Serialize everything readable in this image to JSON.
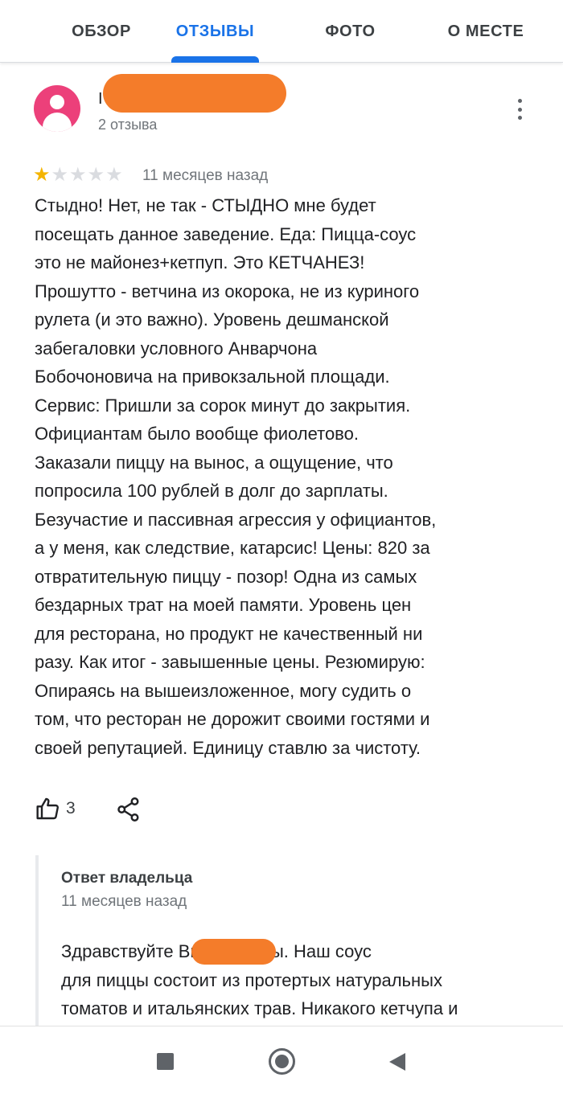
{
  "tabs": [
    {
      "label": "ОБЗОР",
      "active": false
    },
    {
      "label": "ОТЗЫВЫ",
      "active": true
    },
    {
      "label": "ФОТО",
      "active": false
    },
    {
      "label": "О МЕСТЕ",
      "active": false
    }
  ],
  "review": {
    "author_initial": "I",
    "author_review_count": "2 отзыва",
    "rating": 1,
    "rating_max": 5,
    "date": "11 месяцев назад",
    "text": "Стыдно! Нет, не так - СТЫДНО мне будет\nпосещать данное заведение. Еда: Пицца-соус\nэто не майонез+кетпуп. Это КЕТЧАНЕЗ!\nПрошутто - ветчина из окорока, не из куриного\nрулета (и это важно). Уровень дешманской\nзабегаловки условного Анварчона\nБобочоновича на привокзальной площади.\nСервис: Пришли за сорок минут до закрытия.\nОфициантам было вообще фиолетово.\nЗаказали пиццу на вынос, а ощущение, что\nпопросила 100 рублей в долг до зарплаты.\nБезучастие и пассивная агрессия у официантов,\nа у меня, как следствие, катарсис! Цены: 820 за\nотвратительную пиццу - позор!  Одна из самых\nбездарных трат на моей памяти. Уровень цен\nдля ресторана, но продукт не качественный ни\nразу. Как итог - завышенные цены. Резюмирую:\nОпираясь на вышеизложенное, могу судить о\nтом, что ресторан не дорожит своими гостями и\nсвоей репутацией. Единицу ставлю за чистоту.",
    "likes": "3"
  },
  "owner_reply": {
    "label": "Ответ владельца",
    "date": "11 месяцев назад",
    "text": "Здравствуйте                Вы не правы. Наш соус\nдля пиццы состоит из протертых натуральных\nтоматов и итальянских трав. Никакого кетчупа и"
  },
  "icons": {
    "more": "more-vert-icon",
    "like": "thumb-up-icon",
    "share": "share-icon",
    "nav_recent": "square-icon",
    "nav_home": "circle-icon",
    "nav_back": "triangle-back-icon"
  },
  "colors": {
    "accent": "#1a73e8",
    "star": "#f4b400",
    "avatar": "#ec407a",
    "redaction": "#f47c2a"
  }
}
